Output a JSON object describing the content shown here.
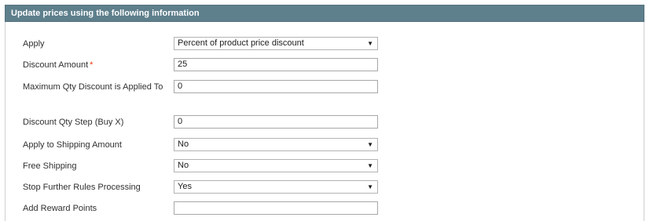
{
  "fieldset": {
    "title": "Update prices using the following information"
  },
  "fields": [
    {
      "label": "Apply",
      "type": "select",
      "value": "Percent of product price discount",
      "required": false
    },
    {
      "label": "Discount Amount",
      "type": "input",
      "value": "25",
      "required": true,
      "required_mark": "*"
    },
    {
      "label": "Maximum Qty Discount is Applied To",
      "type": "input",
      "value": "0",
      "required": false
    },
    {
      "label": "Discount Qty Step (Buy X)",
      "type": "input",
      "value": "0",
      "required": false
    },
    {
      "label": "Apply to Shipping Amount",
      "type": "select",
      "value": "No",
      "required": false
    },
    {
      "label": "Free Shipping",
      "type": "select",
      "value": "No",
      "required": false
    },
    {
      "label": "Stop Further Rules Processing",
      "type": "select",
      "value": "Yes",
      "required": false
    },
    {
      "label": "Add Reward Points",
      "type": "input",
      "value": "",
      "required": false
    }
  ],
  "icons": {
    "dropdown": "triangle-down-icon",
    "dropdown_glyph": "▼"
  }
}
